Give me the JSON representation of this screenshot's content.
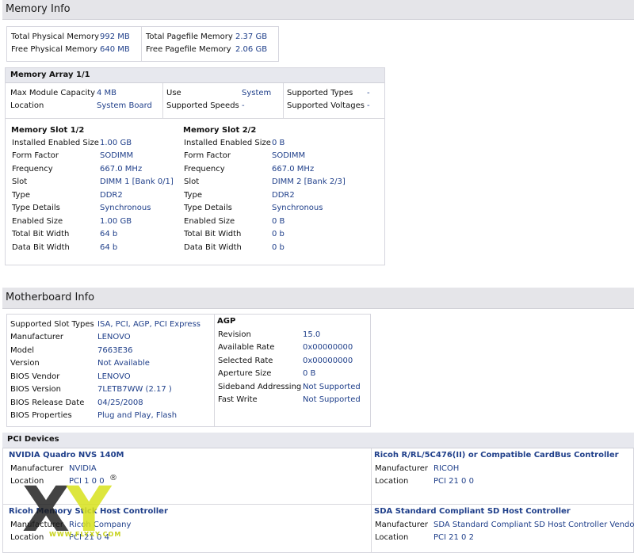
{
  "memory": {
    "title": "Memory Info",
    "summary": [
      {
        "label": "Total Physical Memory",
        "value": "992 MB"
      },
      {
        "label": "Free Physical Memory",
        "value": "640 MB"
      },
      {
        "label": "Total Pagefile Memory",
        "value": "2.37 GB"
      },
      {
        "label": "Free Pagefile Memory",
        "value": "2.06 GB"
      }
    ],
    "array": {
      "title": "Memory Array 1/1",
      "fields": [
        {
          "label": "Max Module Capacity",
          "value": "4 MB"
        },
        {
          "label": "Location",
          "value": "System Board"
        },
        {
          "label": "Use",
          "value": "System"
        },
        {
          "label": "Supported Speeds",
          "value": "-"
        },
        {
          "label": "Supported Types",
          "value": "-"
        },
        {
          "label": "Supported Voltages",
          "value": "-"
        }
      ]
    },
    "slots": [
      {
        "title": "Memory Slot 1/2",
        "fields": [
          {
            "label": "Installed Enabled Size",
            "value": "1.00 GB"
          },
          {
            "label": "Form Factor",
            "value": "SODIMM"
          },
          {
            "label": "Frequency",
            "value": "667.0 MHz"
          },
          {
            "label": "Slot",
            "value": "DIMM 1 [Bank 0/1]"
          },
          {
            "label": "Type",
            "value": "DDR2"
          },
          {
            "label": "Type Details",
            "value": "Synchronous"
          },
          {
            "label": "Enabled Size",
            "value": "1.00 GB"
          },
          {
            "label": "Total Bit Width",
            "value": "64 b"
          },
          {
            "label": "Data Bit Width",
            "value": "64 b"
          }
        ]
      },
      {
        "title": "Memory Slot 2/2",
        "fields": [
          {
            "label": "Installed Enabled Size",
            "value": "0 B"
          },
          {
            "label": "Form Factor",
            "value": "SODIMM"
          },
          {
            "label": "Frequency",
            "value": "667.0 MHz"
          },
          {
            "label": "Slot",
            "value": "DIMM 2 [Bank 2/3]"
          },
          {
            "label": "Type",
            "value": "DDR2"
          },
          {
            "label": "Type Details",
            "value": "Synchronous"
          },
          {
            "label": "Enabled Size",
            "value": "0 B"
          },
          {
            "label": "Total Bit Width",
            "value": "0 b"
          },
          {
            "label": "Data Bit Width",
            "value": "0 b"
          }
        ]
      }
    ]
  },
  "motherboard": {
    "title": "Motherboard Info",
    "fields": [
      {
        "label": "Supported Slot Types",
        "value": "ISA, PCI, AGP, PCI Express"
      },
      {
        "label": "Manufacturer",
        "value": "LENOVO"
      },
      {
        "label": "Model",
        "value": "7663E36"
      },
      {
        "label": "Version",
        "value": "Not Available"
      },
      {
        "label": "BIOS Vendor",
        "value": "LENOVO"
      },
      {
        "label": "BIOS Version",
        "value": "7LETB7WW (2.17 )"
      },
      {
        "label": "BIOS Release Date",
        "value": "04/25/2008"
      },
      {
        "label": "BIOS Properties",
        "value": "Plug and Play, Flash"
      }
    ],
    "agp": {
      "title": "AGP",
      "fields": [
        {
          "label": "Revision",
          "value": "15.0"
        },
        {
          "label": "Available Rate",
          "value": "0x00000000"
        },
        {
          "label": "Selected Rate",
          "value": "0x00000000"
        },
        {
          "label": "Aperture Size",
          "value": "0 B"
        },
        {
          "label": "Sideband Addressing",
          "value": "Not Supported"
        },
        {
          "label": "Fast Write",
          "value": "Not Supported"
        }
      ]
    }
  },
  "pci": {
    "title": "PCI Devices",
    "devices": [
      {
        "name": "NVIDIA Quadro NVS 140M",
        "fields": [
          {
            "label": "Manufacturer",
            "value": "NVIDIA"
          },
          {
            "label": "Location",
            "value": "PCI 1 0 0"
          }
        ]
      },
      {
        "name": "Ricoh R/RL/5C476(II) or Compatible CardBus Controller",
        "fields": [
          {
            "label": "Manufacturer",
            "value": "RICOH"
          },
          {
            "label": "Location",
            "value": "PCI 21 0 0"
          }
        ]
      },
      {
        "name": "Ricoh Memory Stick Host Controller",
        "fields": [
          {
            "label": "Manufacturer",
            "value": "Ricoh Company"
          },
          {
            "label": "Location",
            "value": "PCI 21 0 4"
          }
        ]
      },
      {
        "name": "SDA Standard Compliant SD Host Controller",
        "fields": [
          {
            "label": "Manufacturer",
            "value": "SDA Standard Compliant SD Host Controller Vendor"
          },
          {
            "label": "Location",
            "value": "PCI 21 0 2"
          }
        ]
      }
    ]
  },
  "watermark": {
    "text": "WWW.FLYXY.COM",
    "mark": "®",
    "logo": "XY"
  }
}
